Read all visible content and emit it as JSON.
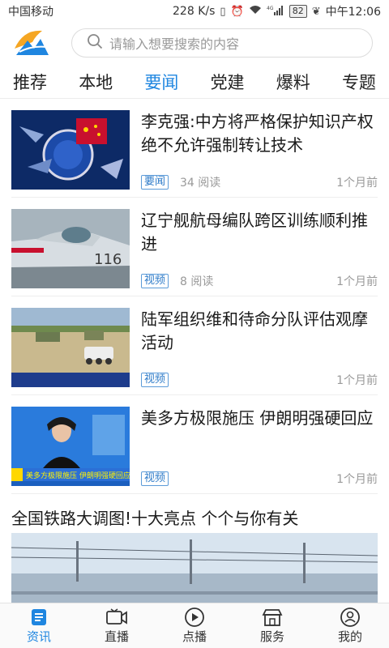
{
  "status_bar": {
    "carrier": "中国移动",
    "speed": "228 K/s",
    "network": "4G",
    "battery": "82",
    "time": "中午12:06"
  },
  "search": {
    "placeholder": "请输入想要搜索的内容"
  },
  "tabs": [
    {
      "label": "推荐"
    },
    {
      "label": "本地"
    },
    {
      "label": "要闻"
    },
    {
      "label": "党建"
    },
    {
      "label": "爆料"
    },
    {
      "label": "专题"
    }
  ],
  "active_tab": "要闻",
  "news": [
    {
      "title": "李克强:中方将严格保护知识产权 绝不允许强制转让技术",
      "tag": "要闻",
      "reads": "34 阅读",
      "time": "1个月前"
    },
    {
      "title": "辽宁舰航母编队跨区训练顺利推进",
      "tag": "视频",
      "reads": "8 阅读",
      "time": "1个月前"
    },
    {
      "title": "陆军组织维和待命分队评估观摩活动",
      "tag": "视频",
      "reads": "",
      "time": "1个月前"
    },
    {
      "title": "美多方极限施压 伊朗明强硬回应",
      "tag": "视频",
      "reads": "",
      "time": "1个月前"
    }
  ],
  "feature": {
    "title": "全国铁路大调图!十大亮点 个个与你有关"
  },
  "thumb_text": {
    "jet_number": "116",
    "ticker": "美多方极限施压 伊朗明强硬回应"
  },
  "bottom_nav": [
    {
      "label": "资讯",
      "icon": "news-icon"
    },
    {
      "label": "直播",
      "icon": "live-camera-icon"
    },
    {
      "label": "点播",
      "icon": "play-icon"
    },
    {
      "label": "服务",
      "icon": "store-icon"
    },
    {
      "label": "我的",
      "icon": "user-icon"
    }
  ],
  "colors": {
    "accent": "#1f86e0",
    "tag_border": "#5c9bd8"
  }
}
